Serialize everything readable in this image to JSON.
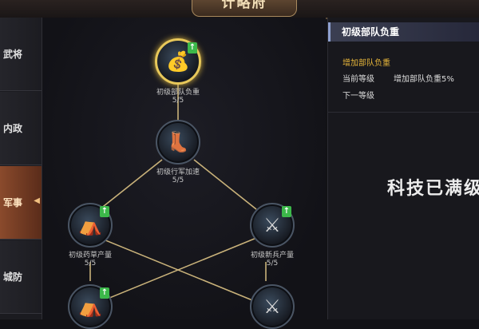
{
  "header": {
    "title": "计略府"
  },
  "sidebar": {
    "tabs": [
      {
        "label": "武将",
        "active": false
      },
      {
        "label": "内政",
        "active": false
      },
      {
        "label": "军事",
        "active": true
      },
      {
        "label": "城防",
        "active": false
      }
    ]
  },
  "tree": {
    "nodes": [
      {
        "name": "初级部队负重",
        "level": "5/5",
        "icon": "supply-bag-icon",
        "selected": true,
        "upgradable": true
      },
      {
        "name": "初级行军加速",
        "level": "5/5",
        "icon": "boot-speed-icon",
        "selected": false,
        "upgradable": false
      },
      {
        "name": "初级药草产量",
        "level": "5/5",
        "icon": "herb-tent-icon",
        "selected": false,
        "upgradable": true
      },
      {
        "name": "初级新兵产量",
        "level": "5/5",
        "icon": "soldier-helmet-icon",
        "selected": false,
        "upgradable": true
      },
      {
        "name": "",
        "level": "",
        "icon": "herb-tent-icon",
        "selected": false,
        "upgradable": true
      },
      {
        "name": "",
        "level": "",
        "icon": "soldier-helmet-icon",
        "selected": false,
        "upgradable": false
      }
    ]
  },
  "detail": {
    "title": "初级部队负重",
    "effect_title": "增加部队负重",
    "current_label": "当前等级",
    "current_value": "增加部队负重5%",
    "next_label": "下一等级",
    "next_value": "",
    "status": "科技已满级"
  },
  "colors": {
    "accent_gold": "#e6b53a",
    "active_tab": "#8a4a2c",
    "link_line": "#c9b27a",
    "upgrade_badge": "#3cb84a"
  }
}
